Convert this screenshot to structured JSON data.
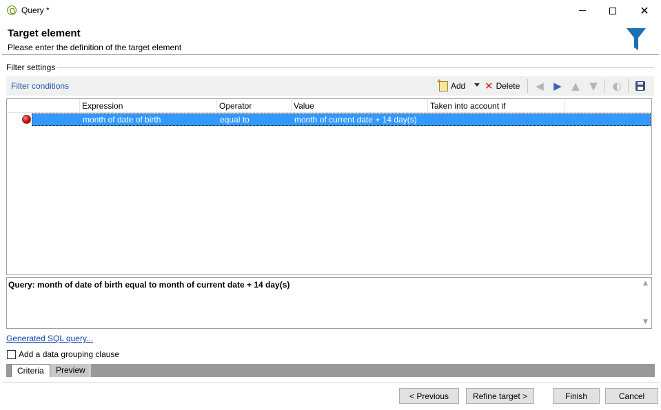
{
  "window": {
    "title": "Query *"
  },
  "header": {
    "title": "Target element",
    "subtitle": "Please enter the definition of the target element"
  },
  "filter_settings": {
    "group_label": "Filter settings",
    "section_label": "Filter conditions",
    "toolbar": {
      "add_label": "Add",
      "delete_label": "Delete"
    },
    "columns": [
      "Expression",
      "Operator",
      "Value",
      "Taken into account if"
    ],
    "rows": [
      {
        "status": "red",
        "expression": "month of date of birth",
        "operator": "equal to",
        "value": "month of current date + 14 day(s)",
        "taken_into_account_if": ""
      }
    ],
    "query_text": "Query: month of date of birth equal to month of current date + 14 day(s)",
    "sql_link": "Generated SQL query...",
    "grouping_clause_label": "Add a data grouping clause",
    "grouping_clause_checked": false
  },
  "tabs": [
    "Criteria",
    "Preview"
  ],
  "footer": {
    "previous_label": "< Previous",
    "refine_label": "Refine target >",
    "finish_label": "Finish",
    "cancel_label": "Cancel"
  },
  "colors": {
    "selection": "#3399ff",
    "link": "#0a3fb0",
    "funnel": "#1a6fb5"
  }
}
